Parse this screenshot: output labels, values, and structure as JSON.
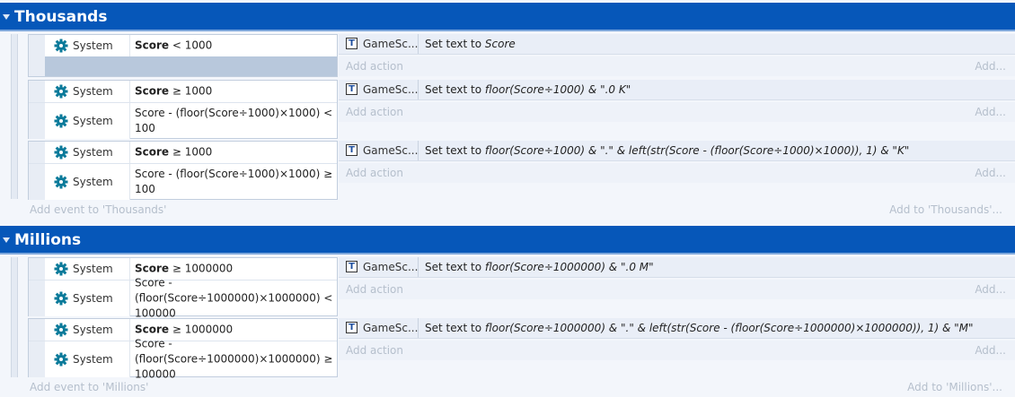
{
  "groups": [
    {
      "title": "Thousands",
      "add_event": "Add event to 'Thousands'",
      "add_event_right": "Add to 'Thousands'...",
      "events": [
        {
          "conditions": [
            {
              "object": "System",
              "bold": "Score",
              "text": " < 1000"
            }
          ],
          "action": {
            "object": "GameSc...",
            "prefix": "Set text to ",
            "expr": "Score"
          }
        },
        {
          "conditions": [
            {
              "object": "System",
              "bold": "Score",
              "text": " ≥ 1000"
            },
            {
              "object": "System",
              "bold": "",
              "text": "Score - (floor(Score÷1000)×1000) < 100"
            }
          ],
          "action": {
            "object": "GameSc...",
            "prefix": "Set text to ",
            "expr": "floor(Score÷1000) & \".0 K\""
          }
        },
        {
          "conditions": [
            {
              "object": "System",
              "bold": "Score",
              "text": " ≥ 1000"
            },
            {
              "object": "System",
              "bold": "",
              "text": "Score - (floor(Score÷1000)×1000) ≥ 100"
            }
          ],
          "action": {
            "object": "GameSc...",
            "prefix": "Set text to ",
            "expr": "floor(Score÷1000) & \".\" & left(str(Score - (floor(Score÷1000)×1000)), 1) & \"K\""
          }
        }
      ]
    },
    {
      "title": "Millions",
      "add_event": "Add event to 'Millions'",
      "add_event_right": "Add to 'Millions'...",
      "events": [
        {
          "conditions": [
            {
              "object": "System",
              "bold": "Score",
              "text": " ≥ 1000000"
            },
            {
              "object": "System",
              "bold": "",
              "text": "Score - (floor(Score÷1000000)×1000000) < 100000"
            }
          ],
          "action": {
            "object": "GameSc...",
            "prefix": "Set text to ",
            "expr": "floor(Score÷1000000) & \".0 M\""
          }
        },
        {
          "conditions": [
            {
              "object": "System",
              "bold": "Score",
              "text": " ≥ 1000000"
            },
            {
              "object": "System",
              "bold": "",
              "text": "Score - (floor(Score÷1000000)×1000000) ≥ 100000"
            }
          ],
          "action": {
            "object": "GameSc...",
            "prefix": "Set text to ",
            "expr": "floor(Score÷1000000) & \".\" & left(str(Score - (floor(Score÷1000000)×1000000)), 1) & \"M\""
          }
        }
      ]
    }
  ],
  "labels": {
    "add_action": "Add action",
    "add_action_right": "Add..."
  },
  "icons": {
    "condition_object": "gear-icon",
    "action_object": "text-object-icon"
  },
  "colors": {
    "group_header": "#0657b9",
    "gear": "#0b7a9a",
    "empty_condition": "#b8c8dc"
  }
}
